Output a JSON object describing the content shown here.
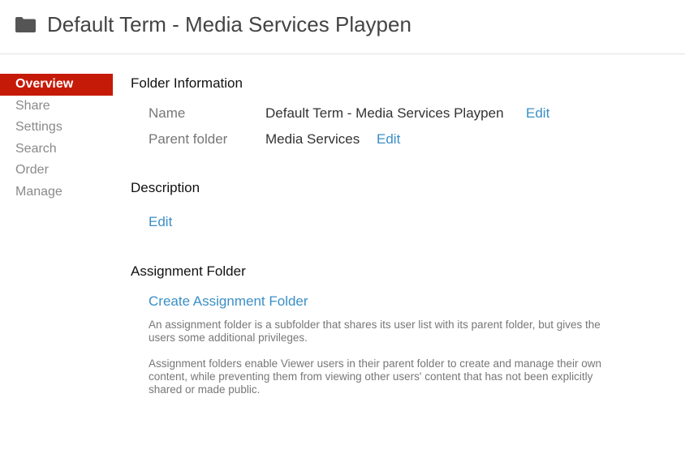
{
  "header": {
    "title": "Default Term - Media Services Playpen",
    "icon": "folder-icon"
  },
  "sidebar": {
    "items": [
      {
        "label": "Overview",
        "active": true
      },
      {
        "label": "Share",
        "active": false
      },
      {
        "label": "Settings",
        "active": false
      },
      {
        "label": "Search",
        "active": false
      },
      {
        "label": "Order",
        "active": false
      },
      {
        "label": "Manage",
        "active": false
      }
    ]
  },
  "folder_info": {
    "title": "Folder Information",
    "name_label": "Name",
    "name_value": "Default Term - Media Services Playpen",
    "name_edit": "Edit",
    "parent_label": "Parent folder",
    "parent_value": "Media Services",
    "parent_edit": "Edit"
  },
  "description": {
    "title": "Description",
    "edit": "Edit"
  },
  "assignment": {
    "title": "Assignment Folder",
    "create_link": "Create Assignment Folder",
    "para1": "An assignment folder is a subfolder that shares its user list with its parent folder, but gives the users some additional privileges.",
    "para2": "Assignment folders enable Viewer users in their parent folder to create and manage their own content, while preventing them from viewing other users' content that has not been explicitly shared or made public."
  },
  "colors": {
    "accent_active": "#c61a08",
    "link": "#3b8fc6"
  }
}
